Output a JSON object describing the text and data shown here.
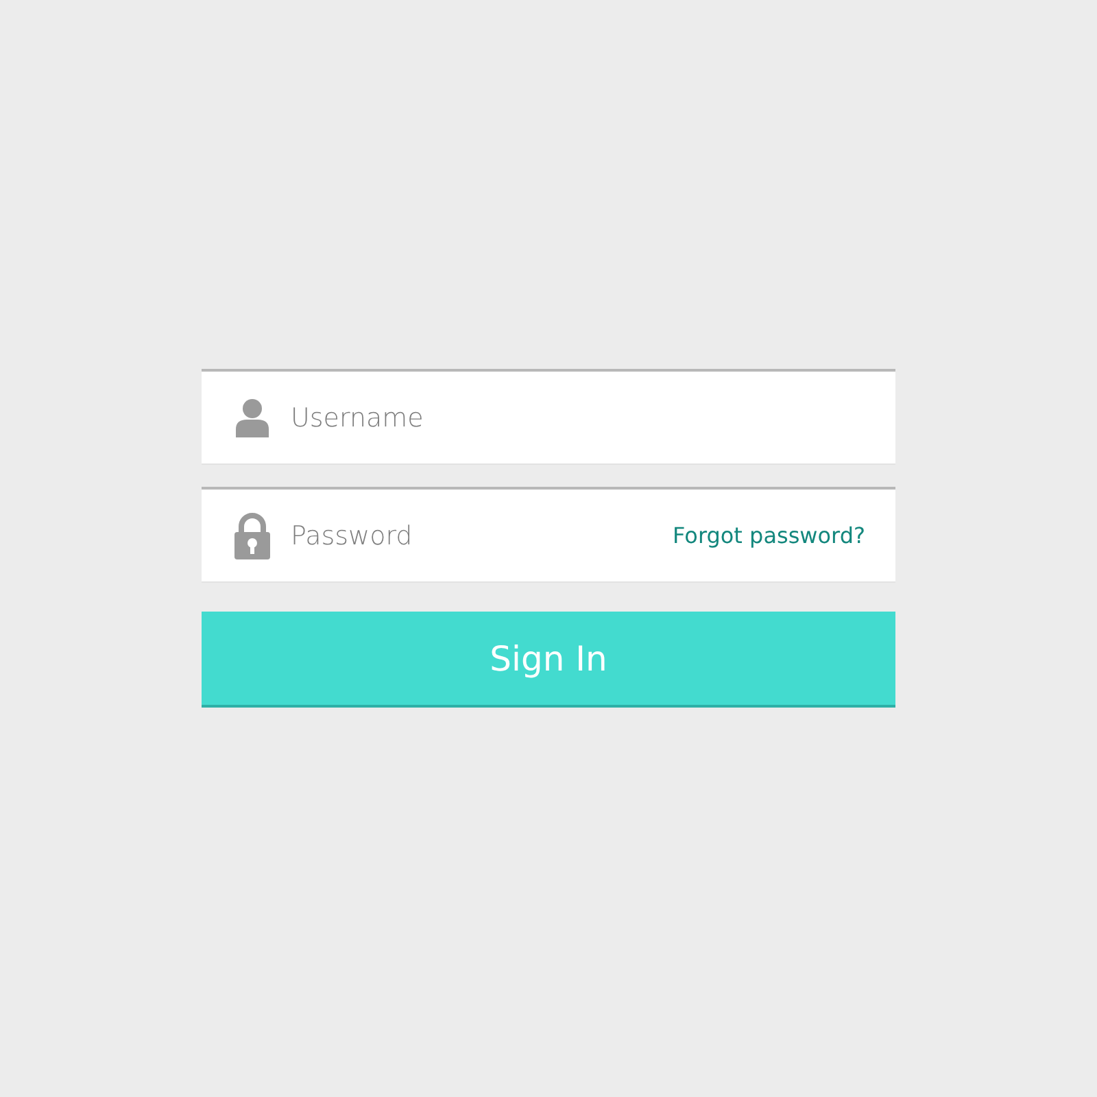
{
  "form": {
    "fields": [
      {
        "kind": "username",
        "placeholder": "Username"
      },
      {
        "kind": "password",
        "placeholder": "Password",
        "link": "Forgot password?"
      }
    ],
    "button": "Sign In"
  }
}
